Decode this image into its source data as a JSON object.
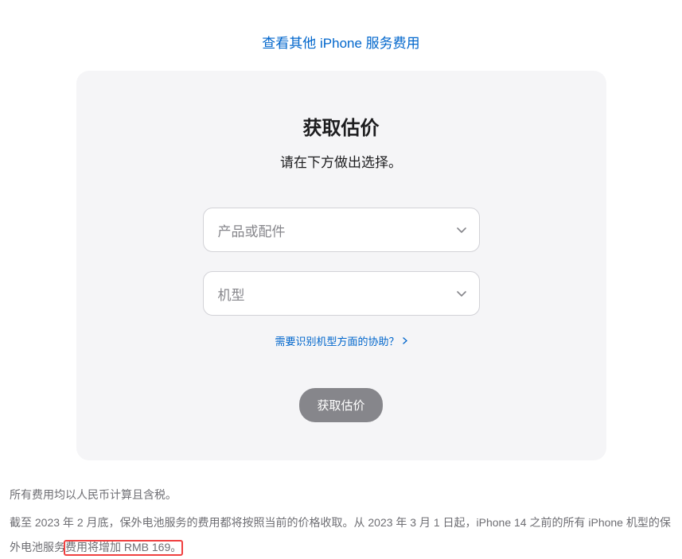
{
  "top_link": "查看其他 iPhone 服务费用",
  "card": {
    "title": "获取估价",
    "subtitle": "请在下方做出选择。",
    "select_product_placeholder": "产品或配件",
    "select_model_placeholder": "机型",
    "help_link": "需要识别机型方面的协助？",
    "submit": "获取估价"
  },
  "footer": {
    "line1": "所有费用均以人民币计算且含税。",
    "line2_pre": "截至 2023 年 2 月底，保外电池服务的费用都将按照当前的价格收取。从 2023 年 3 月 1 日起，iPhone 14 之前的所有 iPhone 机型的保外电池服务",
    "line2_highlight": "费用将增加 RMB 169。"
  }
}
